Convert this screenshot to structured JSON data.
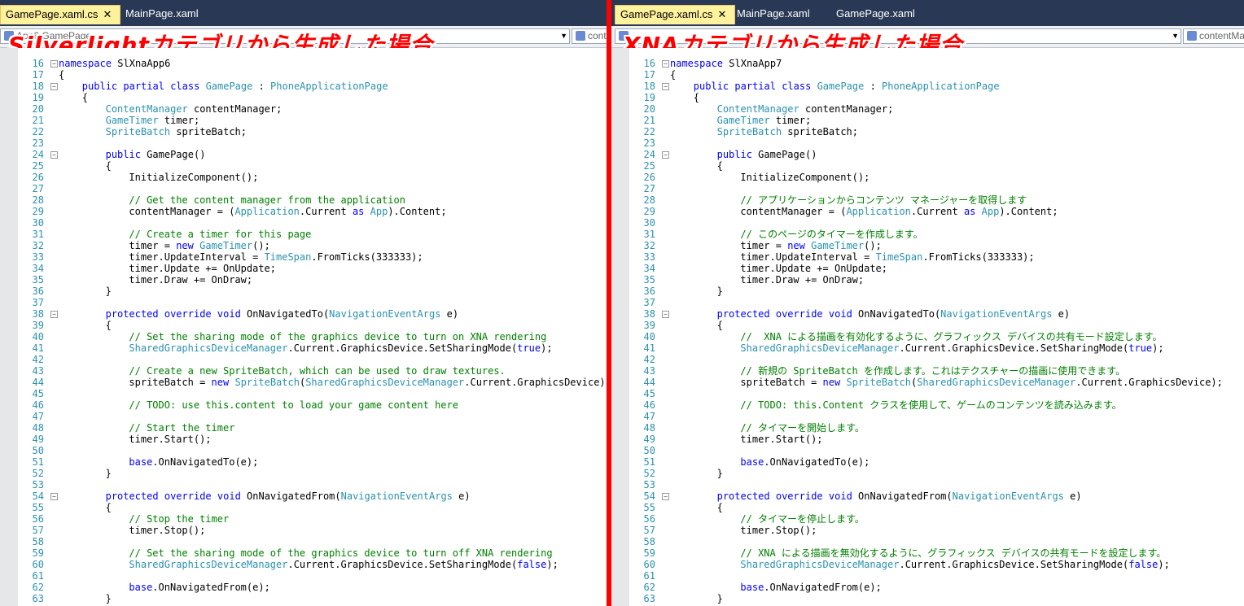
{
  "left": {
    "tabs": [
      {
        "label": "GamePage.xaml.cs",
        "active": true,
        "close": "✕"
      },
      {
        "label": "MainPage.xaml",
        "active": false
      }
    ],
    "nav_left": "App6.GamePage",
    "nav_right": "contentManager",
    "banner": "Silverlightカテゴリから生成した場合",
    "namespace": "SlXnaApp6",
    "comments": {
      "c28": "// Get the content manager from the application",
      "c31": "// Create a timer for this page",
      "c40": "// Set the sharing mode of the graphics device to turn on XNA rendering",
      "c43": "// Create a new SpriteBatch, which can be used to draw textures.",
      "c46": "// TODO: use this.content to load your game content here",
      "c48": "// Start the timer",
      "c56": "// Stop the timer",
      "c59": "// Set the sharing mode of the graphics device to turn off XNA rendering"
    }
  },
  "right": {
    "tabs": [
      {
        "label": "GamePage.xaml.cs",
        "active": true,
        "close": "✕"
      },
      {
        "label": "MainPage.xaml",
        "active": false
      },
      {
        "label": "GamePage.xaml",
        "active": false
      }
    ],
    "nav_left": "",
    "nav_right": "contentManager",
    "banner": "XNAカテゴリから生成した場合",
    "namespace": "SlXnaApp7",
    "comments": {
      "c28": "// アプリケーションからコンテンツ マネージャーを取得します",
      "c31": "// このページのタイマーを作成します。",
      "c40": "//  XNA による描画を有効化するように、グラフィックス デバイスの共有モード設定します。",
      "c43": "// 新規の SpriteBatch を作成します。これはテクスチャーの描画に使用できます。",
      "c46": "// TODO: this.Content クラスを使用して、ゲームのコンテンツを読み込みます。",
      "c48": "// タイマーを開始します。",
      "c56": "// タイマーを停止します。",
      "c59": "// XNA による描画を無効化するように、グラフィックス デバイスの共有モードを設定します。"
    }
  },
  "code": {
    "kw_namespace": "namespace",
    "kw_public": "public",
    "kw_partial": "partial",
    "kw_class": "class",
    "kw_new": "new",
    "kw_as": "as",
    "kw_protected": "protected",
    "kw_override": "override",
    "kw_void": "void",
    "kw_base": "base",
    "kw_true": "true",
    "kw_false": "false",
    "ty_GamePage": "GamePage",
    "ty_PhoneApplicationPage": "PhoneApplicationPage",
    "ty_ContentManager": "ContentManager",
    "ty_GameTimer": "GameTimer",
    "ty_SpriteBatch": "SpriteBatch",
    "ty_Application": "Application",
    "ty_App": "App",
    "ty_TimeSpan": "TimeSpan",
    "ty_NavigationEventArgs": "NavigationEventArgs",
    "ty_SharedGraphicsDeviceManager": "SharedGraphicsDeviceManager",
    "t_open": "{",
    "t_close": "}",
    "t_colon": " : ",
    "t_contentManager_decl": " contentManager;",
    "t_timer_decl": " timer;",
    "t_spriteBatch_decl": " spriteBatch;",
    "t_GamePage_ctor": " GamePage()",
    "t_InitializeComponent": "InitializeComponent();",
    "t_cm_assign": "contentManager = (",
    "t_current_sp": ".Current ",
    "t_content_end": ").Content;",
    "t_timer_new": "timer = ",
    "t_paren_semi": "();",
    "t_interval": "timer.UpdateInterval = ",
    "t_fromticks": ".FromTicks(333333);",
    "t_update": "timer.Update += OnUpdate;",
    "t_draw": "timer.Draw += OnDraw;",
    "t_onnavto": " OnNavigatedTo(",
    "t_onnavfrom": " OnNavigatedFrom(",
    "t_e_close": " e)",
    "t_setsharing": ".Current.GraphicsDevice.SetSharingMode(",
    "t_close_semi": ");",
    "t_sb_assign": "spriteBatch = ",
    "t_open_paren": "(",
    "t_cur_gd": ".Current.GraphicsDevice);",
    "t_start": "timer.Start();",
    "t_stop": "timer.Stop();",
    "t_base_navto": ".OnNavigatedTo(e);",
    "t_base_navfrom": ".OnNavigatedFrom(e);",
    "t_sp": " ",
    "ln": {
      "l16": "16",
      "l17": "17",
      "l18": "18",
      "l19": "19",
      "l20": "20",
      "l21": "21",
      "l22": "22",
      "l23": "23",
      "l24": "24",
      "l25": "25",
      "l26": "26",
      "l27": "27",
      "l28": "28",
      "l29": "29",
      "l30": "30",
      "l31": "31",
      "l32": "32",
      "l33": "33",
      "l34": "34",
      "l35": "35",
      "l36": "36",
      "l37": "37",
      "l38": "38",
      "l39": "39",
      "l40": "40",
      "l41": "41",
      "l42": "42",
      "l43": "43",
      "l44": "44",
      "l45": "45",
      "l46": "46",
      "l47": "47",
      "l48": "48",
      "l49": "49",
      "l50": "50",
      "l51": "51",
      "l52": "52",
      "l53": "53",
      "l54": "54",
      "l55": "55",
      "l56": "56",
      "l57": "57",
      "l58": "58",
      "l59": "59",
      "l60": "60",
      "l61": "61",
      "l62": "62",
      "l63": "63"
    }
  }
}
